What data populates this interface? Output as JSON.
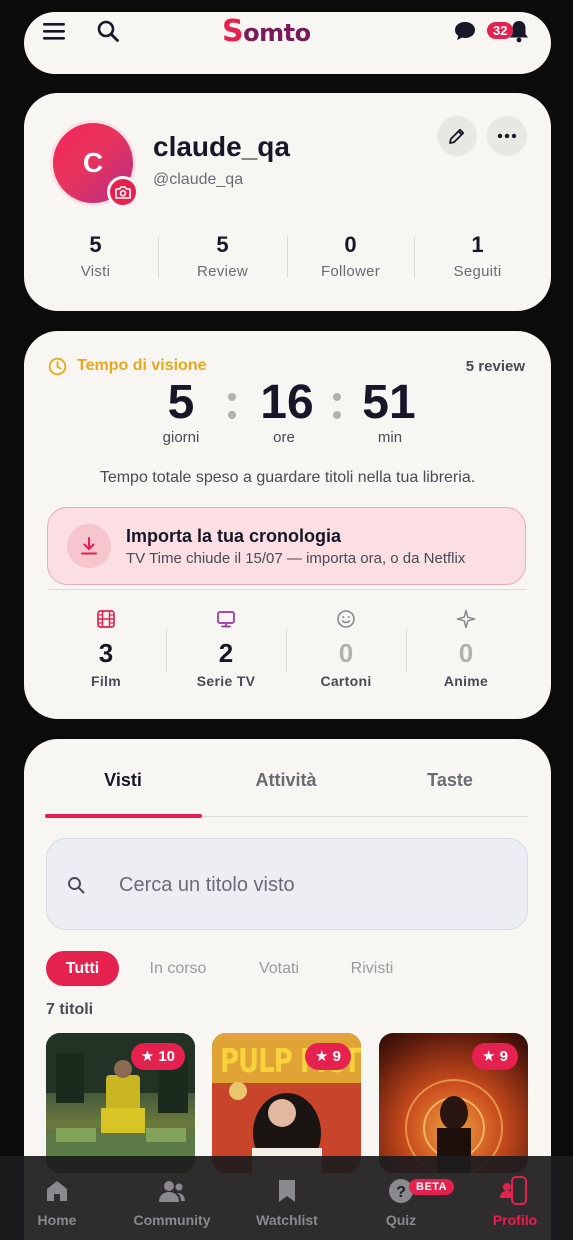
{
  "app": {
    "logo_s": "S",
    "logo_rest": "omto"
  },
  "topbar": {
    "notifications_count": "32"
  },
  "profile": {
    "avatar_letter": "C",
    "username": "claude_qa",
    "handle": "@claude_qa",
    "stats": [
      {
        "value": "5",
        "label": "Visti"
      },
      {
        "value": "5",
        "label": "Review"
      },
      {
        "value": "0",
        "label": "Follower"
      },
      {
        "value": "1",
        "label": "Seguiti"
      }
    ]
  },
  "watchtime": {
    "title": "Tempo di visione",
    "reviews": "5 review",
    "days": "5",
    "days_label": "giorni",
    "hours": "16",
    "hours_label": "ore",
    "minutes": "51",
    "minutes_label": "min",
    "description": "Tempo totale speso a guardare titoli nella tua libreria.",
    "import_title": "Importa la tua cronologia",
    "import_subtitle": "TV Time chiude il 15/07 — importa ora, o da Netflix",
    "categories": [
      {
        "value": "3",
        "label": "Film"
      },
      {
        "value": "2",
        "label": "Serie TV"
      },
      {
        "value": "0",
        "label": "Cartoni"
      },
      {
        "value": "0",
        "label": "Anime"
      }
    ]
  },
  "library": {
    "tabs": [
      "Visti",
      "Attività",
      "Taste"
    ],
    "search_placeholder": "Cerca un titolo visto",
    "filters": [
      "Tutti",
      "In corso",
      "Votati",
      "Rivisti"
    ],
    "count_label": "7 titoli",
    "posters": [
      {
        "rating": "10",
        "art_text": ""
      },
      {
        "rating": "9",
        "art_text": "PULP FICTI"
      },
      {
        "rating": "9",
        "art_text": ""
      }
    ]
  },
  "bottom_nav": {
    "items": [
      "Home",
      "Community",
      "Watchlist",
      "Quiz",
      "Profilo"
    ],
    "quiz_badge": "BETA"
  },
  "colors": {
    "accent": "#e5224f",
    "gold": "#e8a817",
    "card": "#f8f6f2"
  }
}
